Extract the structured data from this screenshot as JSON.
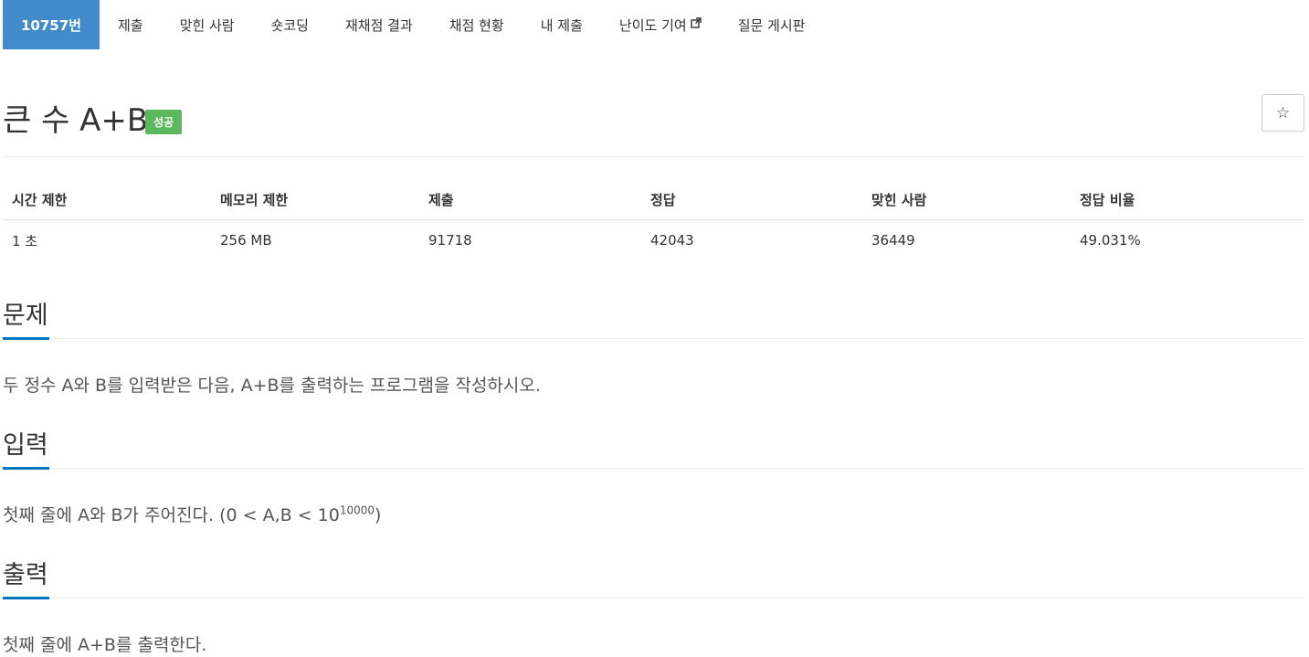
{
  "nav": {
    "items": [
      {
        "label": "10757번",
        "active": true
      },
      {
        "label": "제출"
      },
      {
        "label": "맞힌 사람"
      },
      {
        "label": "숏코딩"
      },
      {
        "label": "재채점 결과"
      },
      {
        "label": "채점 현황"
      },
      {
        "label": "내 제출"
      },
      {
        "label": "난이도 기여",
        "external": true
      },
      {
        "label": "질문 게시판"
      }
    ]
  },
  "problem": {
    "title": "큰 수 A+B",
    "badge": "성공",
    "star_icon": "☆"
  },
  "info_table": {
    "headers": [
      "시간 제한",
      "메모리 제한",
      "제출",
      "정답",
      "맞힌 사람",
      "정답 비율"
    ],
    "values": [
      "1 초",
      "256 MB",
      "91718",
      "42043",
      "36449",
      "49.031%"
    ]
  },
  "sections": {
    "description": {
      "title": "문제",
      "body": "두 정수 A와 B를 입력받은 다음, A+B를 출력하는 프로그램을 작성하시오."
    },
    "input": {
      "title": "입력",
      "body_prefix": "첫째 줄에 A와 B가 주어진다. (0 < A,B < 10",
      "body_exponent": "10000",
      "body_suffix": ")"
    },
    "output": {
      "title": "출력",
      "body": "첫째 줄에 A+B를 출력한다."
    }
  },
  "colors": {
    "active_tab": "#428bca",
    "success_badge": "#5cb85c",
    "section_accent": "#0076c0"
  }
}
